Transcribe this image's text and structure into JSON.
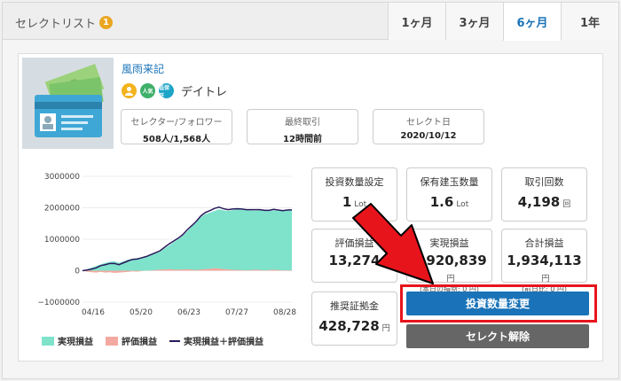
{
  "header": {
    "title": "セレクトリスト",
    "badge_count": "1",
    "tabs": [
      {
        "label": "1ヶ月",
        "active": false
      },
      {
        "label": "3ヶ月",
        "active": false
      },
      {
        "label": "6ヶ月",
        "active": true
      },
      {
        "label": "1年",
        "active": false
      }
    ]
  },
  "trader": {
    "name": "風雨来記",
    "badge_popular": "人気",
    "badge_low": "低保証",
    "style": "デイトレ",
    "stats": [
      {
        "label": "セレクター/フォロワー",
        "value": "508人/1,568人"
      },
      {
        "label": "最終取引",
        "value": "12時間前"
      },
      {
        "label": "セレクト日",
        "value": "2020/10/12"
      }
    ]
  },
  "metrics": {
    "lot_setting": {
      "label": "投資数量設定",
      "value": "1",
      "unit": "Lot"
    },
    "open_position": {
      "label": "保有建玉数量",
      "value": "1.6",
      "unit": "Lot"
    },
    "trade_count": {
      "label": "取引回数",
      "value": "4,198",
      "unit": "回"
    },
    "unrealized": {
      "label": "評価損益",
      "value": "13,274",
      "unit": ""
    },
    "realized": {
      "label": "実現損益",
      "value": "1,920,839",
      "unit": "円",
      "sub": "(本日の損益: 0 円)"
    },
    "total": {
      "label": "合計損益",
      "value": "1,934,113",
      "unit": "円",
      "sub": "(前日比: 0 円)"
    },
    "margin": {
      "label": "推奨証拠金",
      "value": "428,728",
      "unit": "円"
    }
  },
  "buttons": {
    "change_lot": "投資数量変更",
    "deselect": "セレクト解除"
  },
  "legend": {
    "realized": "実現損益",
    "unrealized": "評価損益",
    "total": "実現損益＋評価損益"
  },
  "colors": {
    "accent": "#1a73b8",
    "realized_fill": "#7fe3cc",
    "unrealized_fill": "#f4a9a0",
    "total_line": "#2a1a5c",
    "highlight": "#e8141c"
  },
  "chart_data": {
    "type": "area",
    "y_ticks": [
      "3000000",
      "2000000",
      "1000000",
      "0",
      "−1000000"
    ],
    "x_ticks": [
      "04/16",
      "05/20",
      "06/23",
      "07/27",
      "08/28"
    ],
    "ylim": [
      -1000000,
      3000000
    ],
    "x": [
      0,
      5,
      10,
      15,
      20,
      25,
      30,
      35,
      40,
      45,
      50,
      55,
      60,
      65,
      70,
      75,
      80,
      85,
      90,
      95,
      100,
      105,
      110,
      115,
      120,
      125,
      130,
      135,
      140,
      145,
      150,
      155,
      160,
      165,
      170,
      175,
      180,
      185,
      190,
      195,
      200,
      205,
      210,
      215,
      220,
      225,
      230
    ],
    "series": [
      {
        "name": "実現損益",
        "values": [
          0,
          50000,
          100000,
          150000,
          200000,
          250000,
          280000,
          300000,
          250000,
          300000,
          350000,
          380000,
          400000,
          420000,
          450000,
          500000,
          550000,
          600000,
          700000,
          800000,
          900000,
          1000000,
          1100000,
          1250000,
          1400000,
          1550000,
          1700000,
          1800000,
          1850000,
          1900000,
          1950000,
          1920000,
          1900000,
          1930000,
          1950000,
          1940000,
          1930000,
          1920000,
          1910000,
          1920000,
          1910000,
          1900000,
          1920000,
          1910000,
          1900000,
          1920000,
          1920000
        ]
      },
      {
        "name": "評価損益",
        "values": [
          0,
          -30000,
          -50000,
          -60000,
          -40000,
          -60000,
          -50000,
          -70000,
          -60000,
          -50000,
          -40000,
          -20000,
          -30000,
          -10000,
          0,
          10000,
          20000,
          30000,
          40000,
          50000,
          40000,
          30000,
          40000,
          50000,
          30000,
          20000,
          40000,
          50000,
          60000,
          80000,
          70000,
          50000,
          40000,
          30000,
          20000,
          20000,
          10000,
          20000,
          30000,
          20000,
          10000,
          20000,
          30000,
          20000,
          10000,
          10000,
          13274
        ]
      },
      {
        "name": "実現損益＋評価損益",
        "values": [
          0,
          20000,
          50000,
          90000,
          160000,
          190000,
          230000,
          230000,
          190000,
          250000,
          310000,
          360000,
          370000,
          410000,
          450000,
          510000,
          570000,
          630000,
          740000,
          850000,
          940000,
          1030000,
          1140000,
          1300000,
          1430000,
          1570000,
          1740000,
          1850000,
          1910000,
          1980000,
          2020000,
          1970000,
          1940000,
          1960000,
          1970000,
          1960000,
          1940000,
          1940000,
          1940000,
          1940000,
          1920000,
          1920000,
          1950000,
          1930000,
          1910000,
          1930000,
          1934113
        ]
      }
    ]
  }
}
